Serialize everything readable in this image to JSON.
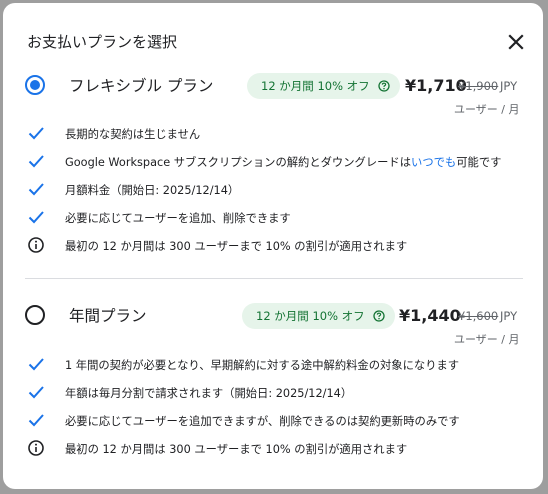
{
  "dialog": {
    "title": "お支払いプランを選択"
  },
  "plans": [
    {
      "name": "フレキシブル プラン",
      "selected": true,
      "badge": "12 か月間 10% オフ",
      "price": "¥1,710",
      "original_price": "¥1,900",
      "currency": "JPY",
      "unit": "ユーザー / 月",
      "features": [
        {
          "icon": "check-icon",
          "text": "長期的な契約は生じません"
        },
        {
          "icon": "check-icon",
          "text_before": "Google Workspace サブスクリプションの解約とダウングレードは",
          "link": "いつでも",
          "text_after": "可能です"
        },
        {
          "icon": "check-icon",
          "text": "月額料金（開始日: 2025/12/14）"
        },
        {
          "icon": "check-icon",
          "text": "必要に応じてユーザーを追加、削除できます"
        },
        {
          "icon": "info-icon",
          "text": "最初の 12 か月間は 300 ユーザーまで 10% の割引が適用されます"
        }
      ]
    },
    {
      "name": "年間プラン",
      "selected": false,
      "badge": "12 か月間 10% オフ",
      "price": "¥1,440",
      "original_price": "¥1,600",
      "currency": "JPY",
      "unit": "ユーザー / 月",
      "features": [
        {
          "icon": "check-icon",
          "text": "1 年間の契約が必要となり、早期解約に対する途中解約料金の対象になります"
        },
        {
          "icon": "check-icon",
          "text": "年額は毎月分割で請求されます（開始日: 2025/12/14）"
        },
        {
          "icon": "check-icon",
          "text": "必要に応じてユーザーを追加できますが、削除できるのは契約更新時のみです"
        },
        {
          "icon": "info-icon",
          "text": "最初の 12 か月間は 300 ユーザーまで 10% の割引が適用されます"
        }
      ]
    }
  ],
  "colors": {
    "accent": "#1a73e8",
    "badge_bg": "#e6f4ea",
    "badge_text": "#137333",
    "text": "#202124",
    "secondary": "#5f6368"
  }
}
